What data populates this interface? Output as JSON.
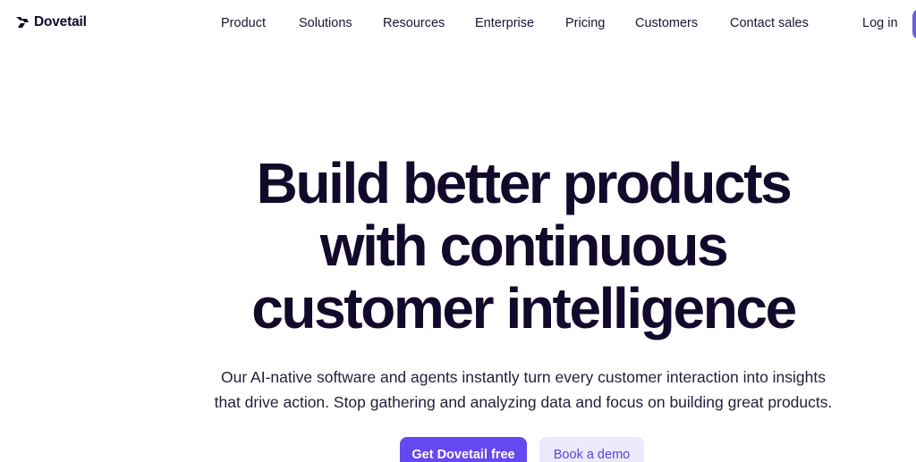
{
  "brand": {
    "name": "Dovetail",
    "logo_icon": "dovetail-logo-icon"
  },
  "nav": {
    "links": [
      {
        "label": "Product"
      },
      {
        "label": "Solutions"
      },
      {
        "label": "Resources"
      },
      {
        "label": "Enterprise"
      },
      {
        "label": "Pricing"
      },
      {
        "label": "Customers"
      },
      {
        "label": "Contact sales"
      }
    ],
    "login_label": "Log in"
  },
  "hero": {
    "title_lines": [
      "Build better products",
      "with continuous",
      "customer intelligence"
    ],
    "subtitle_lines": [
      "Our AI-native software and agents instantly turn every customer interaction into insights",
      "that drive action. Stop gathering and analyzing data and focus on building great products."
    ],
    "primary_cta": "Get Dovetail free",
    "secondary_cta": "Book a demo"
  },
  "colors": {
    "primary": "#6548f0",
    "secondary_bg": "#ece9fd",
    "secondary_text": "#5a45d8",
    "heading": "#12092b"
  }
}
